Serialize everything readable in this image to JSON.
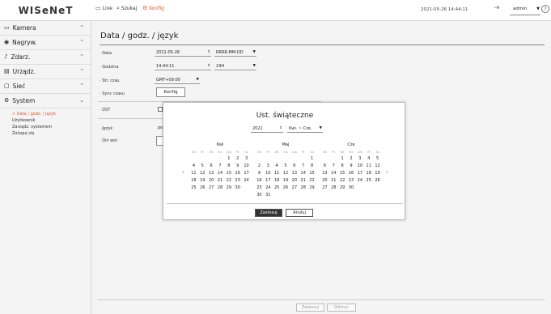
{
  "brand": {
    "logo": "WISeNeT"
  },
  "topnav": {
    "live": "Live",
    "search": "Szukaj",
    "setup": "Konfig",
    "datetime": "2021-05-26 14:44:11",
    "user": "admin",
    "help": "?"
  },
  "colors": {
    "accent": "#e8542a"
  },
  "sidebar": {
    "items": [
      {
        "label": "Kamera",
        "icon": "camera-icon"
      },
      {
        "label": "Nagryw.",
        "icon": "record-icon"
      },
      {
        "label": "Zdarz.",
        "icon": "bell-icon"
      },
      {
        "label": "Urządz.",
        "icon": "device-icon"
      },
      {
        "label": "Sieć",
        "icon": "network-icon"
      },
      {
        "label": "System",
        "icon": "gear-icon"
      }
    ],
    "system_sub": [
      "Data / godz. / język",
      "Użytkownik",
      "Zarządz. systemem",
      "Zaloguj się"
    ]
  },
  "page": {
    "title": "Data / godz. / język",
    "labels": {
      "date": "Data",
      "time": "Godzina",
      "timezone": "Str. czas.",
      "sync": "Sync czasu",
      "dst": "DST",
      "language": "Język",
      "holiday": "Dni wol"
    },
    "date_value": "2021-05-26",
    "date_format": "RRRR-MM-DD",
    "time_value": "14:44:11",
    "time_format": "24H",
    "timezone_value": "GMT+09:00",
    "sync_button": "Konfig",
    "language_value": "po",
    "apply": "Zastosuj",
    "cancel": "Odrzuć"
  },
  "modal": {
    "title": "Ust. świąteczne",
    "year": "2021",
    "range": "Kwi. ~ Cze.",
    "weekdays": [
      "Nd",
      "Pn",
      "Wt",
      "Śro",
      "Czw",
      "Pt",
      "So"
    ],
    "months": [
      {
        "name": "Kwi",
        "offset": 4,
        "days": 30
      },
      {
        "name": "Maj",
        "offset": 6,
        "days": 31
      },
      {
        "name": "Cze",
        "offset": 2,
        "days": 30
      }
    ],
    "ok": "Zastosuj",
    "cancel": "Anuluj"
  }
}
